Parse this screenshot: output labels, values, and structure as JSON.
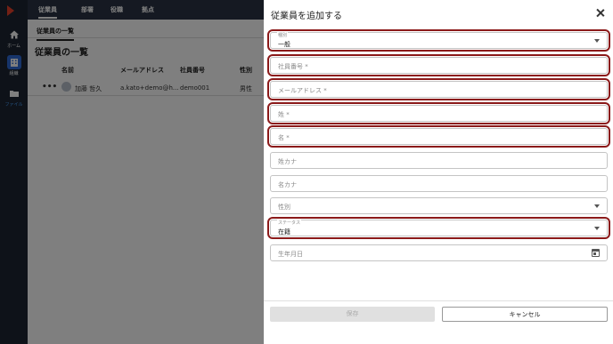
{
  "nav": {
    "items": [
      {
        "label": "ホーム",
        "icon": "home-icon"
      },
      {
        "label": "組織",
        "icon": "organization-icon"
      },
      {
        "label": "ファイル",
        "icon": "folder-icon"
      }
    ]
  },
  "header": {
    "tabs": [
      "従業員",
      "部署",
      "役職",
      "拠点"
    ]
  },
  "main": {
    "subtab": "従業員の一覧",
    "page_title": "従業員の一覧",
    "columns": [
      "名前",
      "メールアドレス",
      "社員番号",
      "性別"
    ],
    "rows": [
      {
        "more": "•••",
        "name": "加藤 哲久",
        "email": "a.kato+demo@h...",
        "employee_no": "demo001",
        "gender": "男性"
      }
    ]
  },
  "drawer": {
    "title": "従業員を追加する",
    "fields": {
      "type": {
        "label": "種別",
        "value": "一般"
      },
      "employee_no": {
        "placeholder": "社員番号 *"
      },
      "email": {
        "placeholder": "メールアドレス *"
      },
      "last_name": {
        "placeholder": "姓 *"
      },
      "first_name": {
        "placeholder": "名 *"
      },
      "last_kana": {
        "placeholder": "姓カナ"
      },
      "first_kana": {
        "placeholder": "名カナ"
      },
      "gender": {
        "placeholder": "性別"
      },
      "status": {
        "label": "ステータス",
        "value": "在籍"
      },
      "birthdate": {
        "placeholder": "生年月日"
      }
    },
    "save_label": "保存",
    "cancel_label": "キャンセル"
  },
  "colors": {
    "accent": "#2f6bd6",
    "highlight": "#8b1a1a",
    "rail": "#1c2533",
    "topbar": "#2a3344"
  }
}
